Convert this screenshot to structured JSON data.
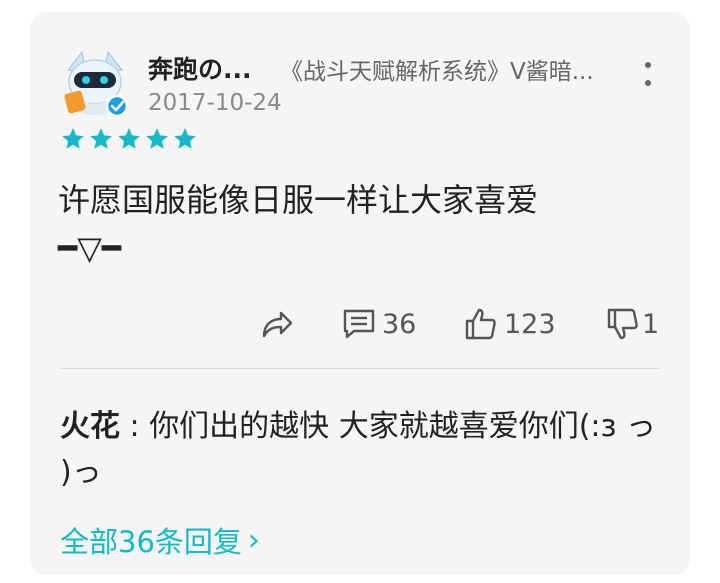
{
  "review": {
    "author": "奔跑の...",
    "game_tag": "《战斗天赋解析系统》V酱暗...",
    "date": "2017-10-24",
    "rating": 5,
    "text_line1": "许愿国服能像日服一样让大家喜爱",
    "text_line2": "━▽━",
    "share_icon": "share-icon",
    "comment_count": "36",
    "like_count": "123",
    "dislike_count": "1"
  },
  "reply": {
    "author": "火花",
    "separator": " : ",
    "text": "你们出的越快 大家就越喜爱你们(:з っ )っ"
  },
  "view_all": {
    "label": "全部36条回复",
    "arrow": "›"
  },
  "colors": {
    "accent": "#14b9c8",
    "star": "#14b9c8",
    "card_bg": "#f5f5f5"
  }
}
